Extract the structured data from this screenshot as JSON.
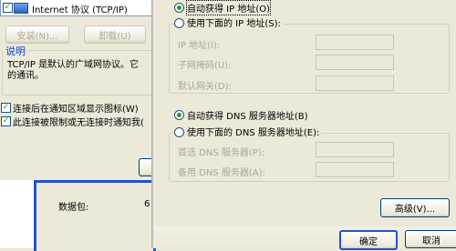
{
  "left": {
    "component_label": "Internet 协议 (TCP/IP)",
    "install_label": "安装(N)...",
    "uninstall_label": "卸载(U)",
    "description_title": "说明",
    "description_line1": "TCP/IP 是默认的广域网协议。它",
    "description_line2": "的通讯。",
    "show_icon_label": "连接后在通知区域显示图标(W)",
    "notify_label": "此连接被限制或无连接时通知我(",
    "packets_label": "数据包:",
    "packets_suffix": "6"
  },
  "right": {
    "auto_ip_label": "自动获得 IP 地址(O)",
    "manual_ip_label": "使用下面的 IP 地址(S):",
    "ip_address_label": "IP 地址(I):",
    "subnet_label": "子网掩码(U):",
    "gateway_label": "默认网关(D):",
    "auto_dns_label": "自动获得 DNS 服务器地址(B)",
    "manual_dns_label": "使用下面的 DNS 服务器地址(E):",
    "preferred_dns_label": "首选 DNS 服务器(P):",
    "alternate_dns_label": "备用 DNS 服务器(A):",
    "advanced_label": "高级(V)...",
    "ok_label": "确定",
    "cancel_label": "取消"
  }
}
